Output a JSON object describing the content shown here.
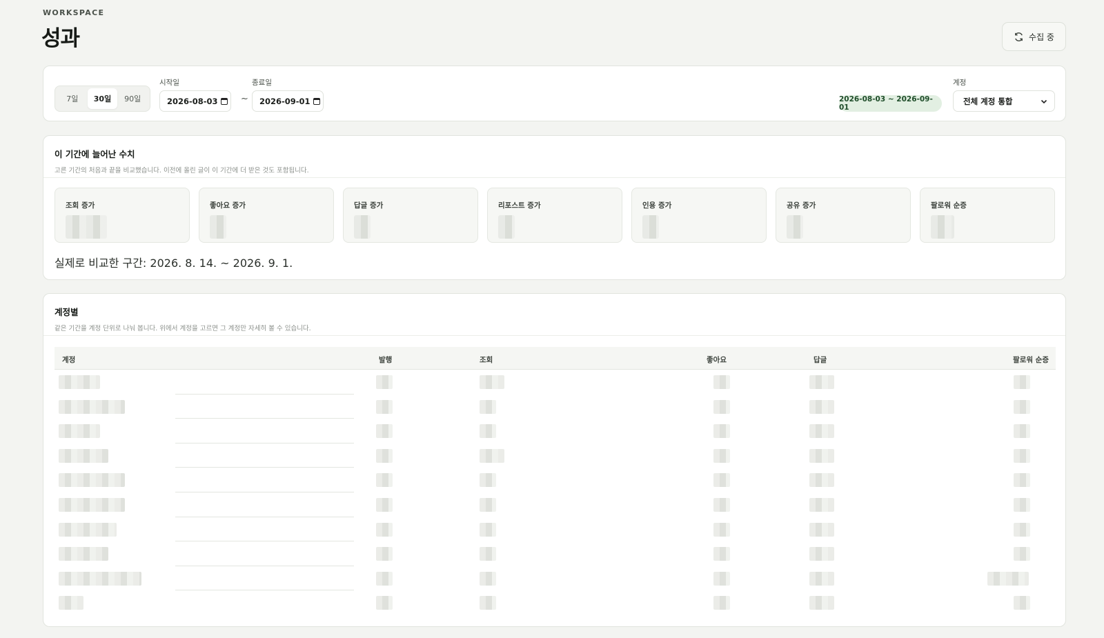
{
  "header": {
    "eyebrow": "WORKSPACE",
    "title": "성과",
    "collect_button": "수집 중"
  },
  "filter": {
    "presets": [
      "7일",
      "30일",
      "90일"
    ],
    "active_preset": "30일",
    "start_label": "시작일",
    "start_value": "2026-08-03",
    "end_label": "종료일",
    "end_value": "2026-09-01",
    "separator": "~",
    "range_badge": "2026-08-03 ~ 2026-09-01",
    "account_label": "계정",
    "account_value": "전체 계정 통합"
  },
  "stats": {
    "title": "이 기간에 늘어난 수치",
    "description": "고른 기간의 처음과 끝을 비교했습니다. 이전에 올린 글이 이 기간에 더 받은 것도 포함됩니다.",
    "items": [
      {
        "label": "조회 증가"
      },
      {
        "label": "좋아요 증가"
      },
      {
        "label": "답글 증가"
      },
      {
        "label": "리포스트 증가"
      },
      {
        "label": "인용 증가"
      },
      {
        "label": "공유 증가"
      },
      {
        "label": "팔로워 순증"
      }
    ],
    "compare_note": "실제로 비교한 구간: 2026. 8. 14. ~ 2026. 9. 1."
  },
  "accounts": {
    "title": "계정별",
    "description": "같은 기간을 계정 단위로 나눠 봅니다. 위에서 계정을 고르면 그 계정만 자세히 볼 수 있습니다.",
    "columns": [
      "계정",
      "발행",
      "조회",
      "좋아요",
      "답글",
      "팔로워 순증"
    ],
    "row_count": 10
  },
  "icons": {
    "collect": "refresh-icon",
    "calendar": "calendar-icon",
    "select": "chevron-down-icon"
  }
}
